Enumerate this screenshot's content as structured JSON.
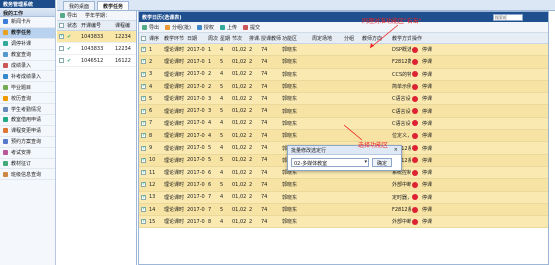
{
  "sidebar": {
    "app_title": "教务管理系统",
    "section": "我的工作",
    "items": [
      {
        "label": "新闻卡片",
        "color": "#3b7dd8"
      },
      {
        "label": "教学任务",
        "color": "#e8a020"
      },
      {
        "label": "调停补课",
        "color": "#3a9"
      },
      {
        "label": "教室查询",
        "color": "#59c"
      },
      {
        "label": "成绩录入",
        "color": "#c55"
      },
      {
        "label": "补考成绩录入",
        "color": "#38c"
      },
      {
        "label": "毕业题目",
        "color": "#7a5"
      },
      {
        "label": "校历查询",
        "color": "#e90"
      },
      {
        "label": "学生考勤情况",
        "color": "#68b"
      },
      {
        "label": "教室借用申请",
        "color": "#2a8"
      },
      {
        "label": "课程变更申请",
        "color": "#d73"
      },
      {
        "label": "预约方案查询",
        "color": "#57c"
      },
      {
        "label": "考试安排",
        "color": "#b59"
      },
      {
        "label": "教材征订",
        "color": "#4a7"
      },
      {
        "label": "班级信息查询",
        "color": "#c84"
      }
    ]
  },
  "tabs": [
    "我的桌面",
    "教学任务"
  ],
  "left_panel": {
    "toolbar": "导出",
    "term": "学年学期：",
    "columns": [
      "状态",
      "开课编号",
      "课程编"
    ],
    "rows": [
      {
        "id": "1043833",
        "code": "12234"
      },
      {
        "id": "1043833",
        "code": "12234"
      },
      {
        "id": "1046512",
        "code": "16122"
      }
    ]
  },
  "right_panel": {
    "title": "教学日历(选课表)",
    "toolbar": [
      "导出",
      "分组(批)",
      "授权",
      "上传",
      "提交"
    ],
    "search_placeholder": "搜索框",
    "columns": [
      "课序",
      "教学环节",
      "日期",
      "周次",
      "星期",
      "节次",
      "排课人数",
      "授课教师",
      "功能区",
      "周定场地",
      "分组",
      "教师方向",
      "教学方式",
      "操作"
    ],
    "rows": [
      {
        "n": "1",
        "stage": "理论课时",
        "date": "2017-0",
        "wk": "1",
        "day": "4",
        "sec": "01,02",
        "num": "2",
        "ppl": "74",
        "t": "郭晓东",
        "method": "DSP概述，",
        "op": "停课"
      },
      {
        "n": "2",
        "stage": "理论课时",
        "date": "2017-0",
        "wk": "1",
        "day": "5",
        "sec": "01,02",
        "num": "2",
        "ppl": "74",
        "t": "郭晓东",
        "method": "F2812数量",
        "op": "停课"
      },
      {
        "n": "3",
        "stage": "理论课时",
        "date": "2017-0",
        "wk": "2",
        "day": "4",
        "sec": "01,02",
        "num": "2",
        "ppl": "74",
        "t": "郭晓东",
        "method": "CCS的特",
        "op": "停课"
      },
      {
        "n": "4",
        "stage": "理论课时",
        "date": "2017-0",
        "wk": "2",
        "day": "5",
        "sec": "01,02",
        "num": "2",
        "ppl": "74",
        "t": "郭晓东",
        "method": "简单示例",
        "op": "停课"
      },
      {
        "n": "5",
        "stage": "理论课时",
        "date": "2017-0",
        "wk": "3",
        "day": "4",
        "sec": "01,02",
        "num": "2",
        "ppl": "74",
        "t": "郭晓东",
        "method": "C语言设计",
        "op": "停课"
      },
      {
        "n": "6",
        "stage": "理论课时",
        "date": "2017-0",
        "wk": "3",
        "day": "5",
        "sec": "01,02",
        "num": "2",
        "ppl": "74",
        "t": "郭晓东",
        "method": "C语言设计",
        "op": "停课"
      },
      {
        "n": "7",
        "stage": "理论课时",
        "date": "2017-0",
        "wk": "4",
        "day": "4",
        "sec": "01,02",
        "num": "2",
        "ppl": "74",
        "t": "郭晓东",
        "method": "C语言设计",
        "op": "停课"
      },
      {
        "n": "8",
        "stage": "理论课时",
        "date": "2017-0",
        "wk": "4",
        "day": "5",
        "sec": "01,02",
        "num": "2",
        "ppl": "74",
        "t": "郭晓东",
        "method": "位定义，外",
        "op": "停课"
      },
      {
        "n": "9",
        "stage": "理论课时",
        "date": "2017-0",
        "wk": "5",
        "day": "4",
        "sec": "01,02",
        "num": "2",
        "ppl": "74",
        "t": "郭晓东",
        "method": "F2812系统",
        "op": "停课"
      },
      {
        "n": "10",
        "stage": "理论课时",
        "date": "2017-0",
        "wk": "5",
        "day": "5",
        "sec": "01,02",
        "num": "2",
        "ppl": "74",
        "t": "郭晓东",
        "method": "F2812系统",
        "op": "停课"
      },
      {
        "n": "11",
        "stage": "理论课时",
        "date": "2017-0",
        "wk": "6",
        "day": "4",
        "sec": "01,02",
        "num": "2",
        "ppl": "74",
        "t": "郭晓东",
        "method": "系统控制",
        "op": "停课"
      },
      {
        "n": "12",
        "stage": "理论课时",
        "date": "2017-0",
        "wk": "6",
        "day": "5",
        "sec": "01,02",
        "num": "2",
        "ppl": "74",
        "t": "郭晓东",
        "method": "外部中断",
        "op": "停课"
      },
      {
        "n": "13",
        "stage": "理论课时",
        "date": "2017-0",
        "wk": "7",
        "day": "4",
        "sec": "01,02",
        "num": "2",
        "ppl": "74",
        "t": "郭晓东",
        "method": "定时器，",
        "op": "停课"
      },
      {
        "n": "14",
        "stage": "理论课时",
        "date": "2017-0",
        "wk": "7",
        "day": "5",
        "sec": "01,02",
        "num": "2",
        "ppl": "74",
        "t": "郭晓东",
        "method": "F2812系统",
        "op": "停课"
      },
      {
        "n": "15",
        "stage": "理论课时",
        "date": "2017-0",
        "wk": "8",
        "day": "4",
        "sec": "01,02",
        "num": "2",
        "ppl": "74",
        "t": "郭晓东",
        "method": "外部中断",
        "op": "停课"
      }
    ]
  },
  "dialog": {
    "title": "批量修改选定行",
    "close": "×",
    "value": "02-多媒体教室",
    "ok": "确定"
  },
  "annotations": {
    "top": "同理对准功能区\"右击\"",
    "mid": "选择功能区"
  }
}
